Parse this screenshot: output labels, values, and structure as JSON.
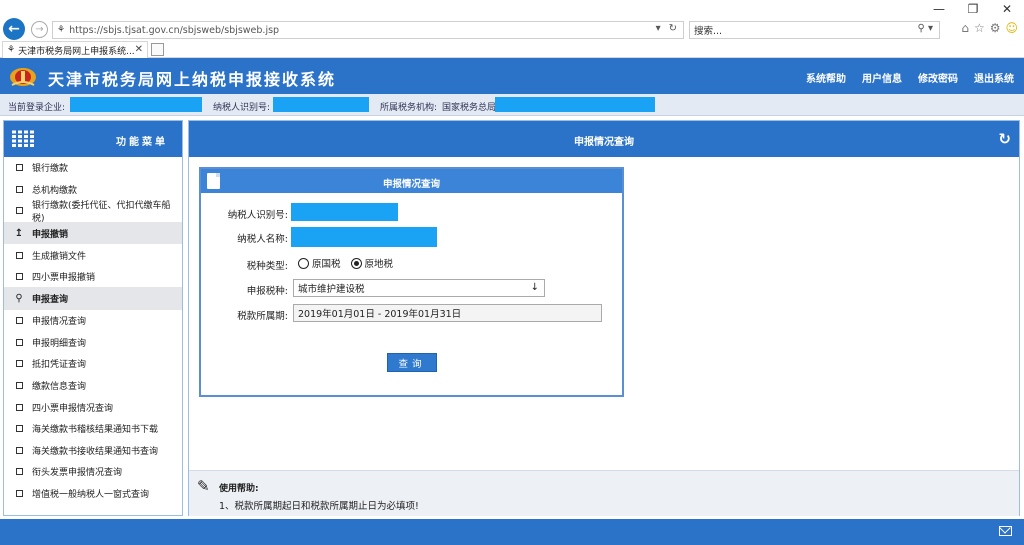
{
  "browser": {
    "address": "https://sbjs.tjsat.gov.cn/sbjsweb/sbjsweb.jsp",
    "search_placeholder": "搜索...",
    "tab_title": "天津市税务局网上申报系统...",
    "favicon_text": "税"
  },
  "header": {
    "title": "天津市税务局网上纳税申报接收系统",
    "nav": [
      "系统帮助",
      "用户信息",
      "修改密码",
      "退出系统"
    ]
  },
  "info_bar": {
    "company_label": "当前登录企业:",
    "taxpayer_id_label": "纳税人识别号:",
    "tax_office_label": "所属税务机构:",
    "tax_office_value": "国家税务总局"
  },
  "sidebar": {
    "title": "功能菜单",
    "items_top": [
      "银行缴款",
      "总机构缴款",
      "银行缴款(委托代征、代扣代缴车船税)"
    ],
    "group_cancel": "申报撤销",
    "items_cancel": [
      "生成撤销文件",
      "四小票申报撤销"
    ],
    "group_query": "申报查询",
    "items_query": [
      "申报情况查询",
      "申报明细查询",
      "抵扣凭证查询",
      "缴款信息查询",
      "四小票申报情况查询",
      "海关缴款书稽核结果通知书下载",
      "海关缴款书接收结果通知书查询",
      "衔头发票申报情况查询",
      "增值税一般纳税人一窗式查询"
    ]
  },
  "main": {
    "panel_title": "申报情况查询",
    "query_box_title": "申报情况查询",
    "taxpayer_id_label": "纳税人识别号:",
    "taxpayer_name_label": "纳税人名称:",
    "tax_type_label": "税种类型:",
    "tax_type_options": [
      "原国税",
      "原地税"
    ],
    "tax_type_selected": "原地税",
    "tax_kind_label": "申报税种:",
    "tax_kind_value": "城市维护建设税",
    "period_label": "税款所属期:",
    "period_value": "2019年01月01日 - 2019年01月31日",
    "query_button": "查询"
  },
  "help": {
    "title": "使用帮助:",
    "text": "1、税款所属期起日和税款所属期止日为必填项!"
  },
  "colors": {
    "primary": "#2b72c9",
    "mask": "#1aa3f5",
    "info_bg": "#e3eaf4"
  }
}
